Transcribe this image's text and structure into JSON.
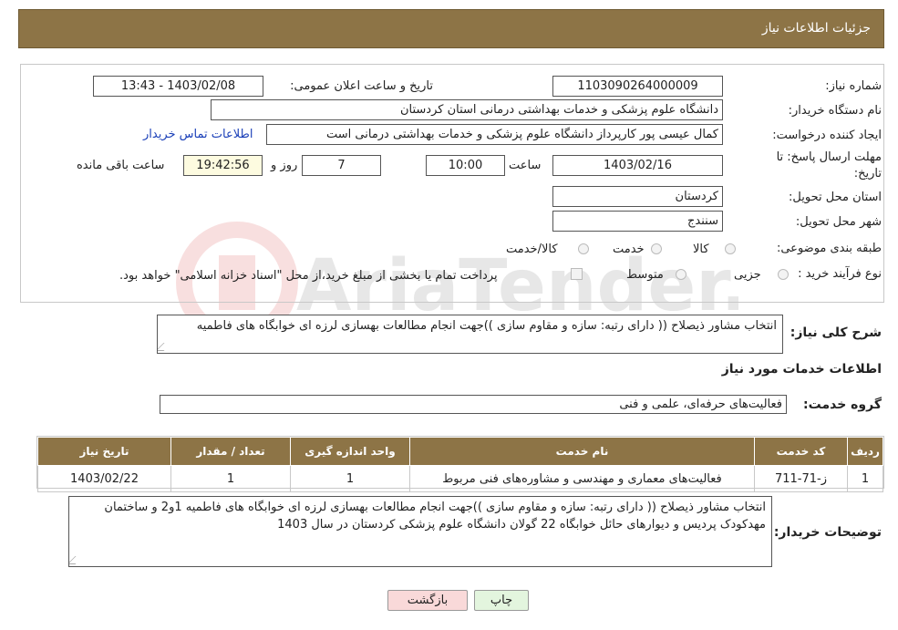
{
  "header": {
    "title": "جزئیات اطلاعات نیاز"
  },
  "form": {
    "need_number_label": "شماره نیاز:",
    "need_number": "1103090264000009",
    "announce_label": "تاریخ و ساعت اعلان عمومی:",
    "announce_value": "1403/02/08 - 13:43",
    "buyer_org_label": "نام دستگاه خریدار:",
    "buyer_org": "دانشگاه علوم پزشکی و خدمات بهداشتی  درمانی استان کردستان",
    "requester_label": "ایجاد کننده درخواست:",
    "requester": "کمال عیسی پور کارپرداز دانشگاه علوم پزشکی و خدمات بهداشتی  درمانی است",
    "contact_link": "اطلاعات تماس خریدار",
    "deadline_label_1": "مهلت ارسال پاسخ: تا",
    "deadline_label_2": "تاریخ:",
    "deadline_date": "1403/02/16",
    "time_label": "ساعت",
    "deadline_time": "10:00",
    "days_value": "7",
    "days_label": "روز و",
    "remaining_time": "19:42:56",
    "remaining_label": "ساعت باقی مانده",
    "province_label": "استان محل تحویل:",
    "province": "کردستان",
    "city_label": "شهر محل تحویل:",
    "city": "سنندج",
    "category_label": "طبقه بندی موضوعی:",
    "category_options": [
      "کالا",
      "خدمت",
      "کالا/خدمت"
    ],
    "process_label": "نوع فرآیند خرید :",
    "process_options": [
      "جزیی",
      "متوسط"
    ],
    "payment_note": "پرداخت تمام یا بخشی از مبلغ خرید،از محل \"اسناد خزانه اسلامی\" خواهد بود."
  },
  "description": {
    "label": "شرح کلی نیاز:",
    "value": "انتخاب مشاور ذیصلاح (( دارای رتبه: سازه و مقاوم سازی ))جهت انجام مطالعات بهسازی لرزه ای خوابگاه های فاطمیه"
  },
  "services": {
    "section_title": "اطلاعات خدمات مورد نیاز",
    "group_label": "گروه خدمت:",
    "group_value": "فعالیت‌های حرفه‌ای، علمی و فنی"
  },
  "table": {
    "headers": [
      "ردیف",
      "کد خدمت",
      "نام خدمت",
      "واحد اندازه گیری",
      "تعداد / مقدار",
      "تاریخ نیاز"
    ],
    "rows": [
      [
        "1",
        "ز-71-711",
        "فعالیت‌های معماری و مهندسی و مشاوره‌های فنی مربوط",
        "1",
        "1",
        "1403/02/22"
      ]
    ]
  },
  "buyer_notes": {
    "label": "توضیحات خریدار:",
    "value": "انتخاب مشاور ذیصلاح (( دارای رتبه: سازه و مقاوم سازی ))جهت انجام مطالعات بهسازی لرزه ای خوابگاه های فاطمیه 1و2 و ساختمان مهدکودک پردیس و دیوارهای حائل خوابگاه 22 گولان دانشگاه علوم پزشکی کردستان در سال 1403"
  },
  "buttons": {
    "print": "چاپ",
    "back": "بازگشت"
  },
  "watermark": "AriaTender.neT",
  "colors": {
    "header_bg": "#8d7446",
    "back_button_bg": "#f9d9d9",
    "print_button_bg": "#e3f5de",
    "link": "#1a3fb8"
  }
}
